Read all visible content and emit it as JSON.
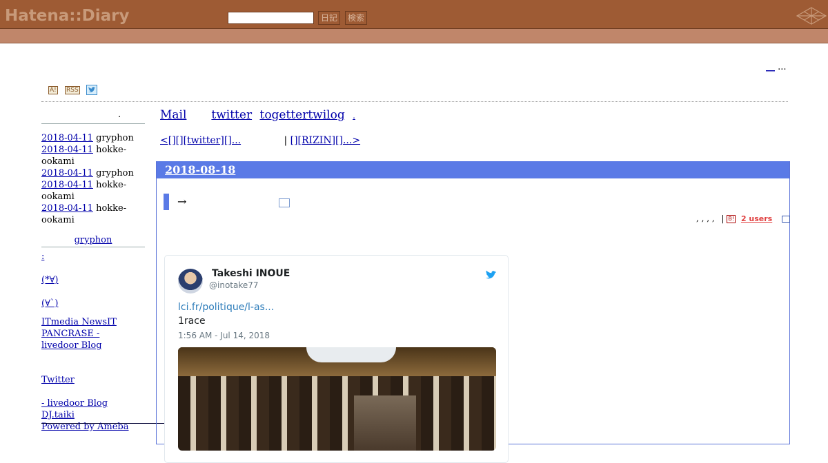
{
  "header": {
    "logo": "Hatena::Diary",
    "search_placeholder": "",
    "diary_button": "日記",
    "search_button": "検索"
  },
  "topright": {
    "link": "__",
    "dots": "..."
  },
  "icons": {
    "antenna": "A!",
    "rss": "RSS",
    "twitter": "twitter-bird-icon"
  },
  "sidebar": {
    "title_dot": ".",
    "recent": [
      {
        "date": "2018-04-11",
        "user": "gryphon"
      },
      {
        "date": "2018-04-11",
        "user": "hokke-ookami"
      },
      {
        "date": "2018-04-11",
        "user": "gryphon"
      },
      {
        "date": "2018-04-11",
        "user": "hokke-ookami"
      },
      {
        "date": "2018-04-11",
        "user": "hokke-ookami"
      }
    ],
    "profile_name": "gryphon",
    "links_a": [
      ":",
      "",
      "(*∀)",
      "",
      "(∀`)"
    ],
    "links_b": [
      "ITmedia NewsIT",
      "PANCRASE -",
      "livedoor Blog"
    ],
    "links_c": [
      "",
      "Twitter",
      "",
      " - livedoor Blog",
      "DJ.taiki",
      "Powered by Ameba"
    ]
  },
  "nav": {
    "links": [
      "Mail",
      "twitter",
      "togettertwilog",
      "."
    ],
    "prev": "<[][][twitter][]...",
    "separator": "|",
    "next": "[][RIZIN][]...>"
  },
  "entry": {
    "date": "2018-08-18",
    "title": "→",
    "meta_dots": ", , , ,",
    "meta_sep": "|",
    "bookmark_icon": "B!",
    "users": "2 users"
  },
  "tweet": {
    "name": "Takeshi INOUE",
    "handle": "@inotake77",
    "link": "lci.fr/politique/l-as...",
    "text": "1race",
    "date": "1:56 AM - Jul 14, 2018"
  },
  "colors": {
    "header_bg": "#9e5b34",
    "subbar_bg": "#c0866a",
    "day_head": "#5a7ae6",
    "link": "#0000aa",
    "tweet_link": "#2b7bb9"
  }
}
